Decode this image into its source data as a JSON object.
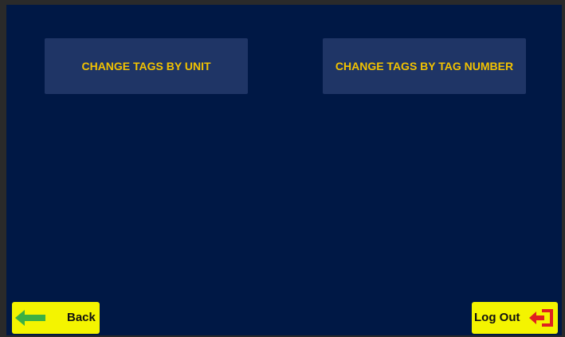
{
  "menu": {
    "change_by_unit": "CHANGE TAGS BY UNIT",
    "change_by_tag_number": "CHANGE TAGS BY TAG NUMBER"
  },
  "footer": {
    "back_label": "Back",
    "logout_label": "Log Out"
  },
  "colors": {
    "background": "#001845",
    "menu_button": "#1f3566",
    "menu_text": "#f2c200",
    "nav_button": "#f4f400",
    "back_arrow": "#3cb043",
    "logout_icon": "#e02020"
  },
  "icons": {
    "back": "arrow-left-icon",
    "logout": "exit-door-icon"
  }
}
